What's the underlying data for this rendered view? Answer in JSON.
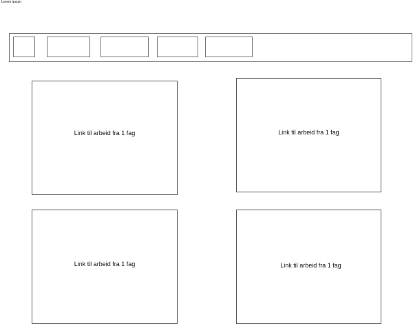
{
  "header": {
    "site_title": "Lorem ipsum"
  },
  "nav": {
    "items": [
      {
        "label": ""
      },
      {
        "label": ""
      },
      {
        "label": ""
      },
      {
        "label": ""
      },
      {
        "label": ""
      }
    ]
  },
  "cards": [
    {
      "label": "Link til arbeid fra 1 fag"
    },
    {
      "label": "Link til arbeid fra 1 fag"
    },
    {
      "label": "Link til arbeid fra 1 fag"
    },
    {
      "label": "Link til arbeid fra 1 fag"
    }
  ]
}
